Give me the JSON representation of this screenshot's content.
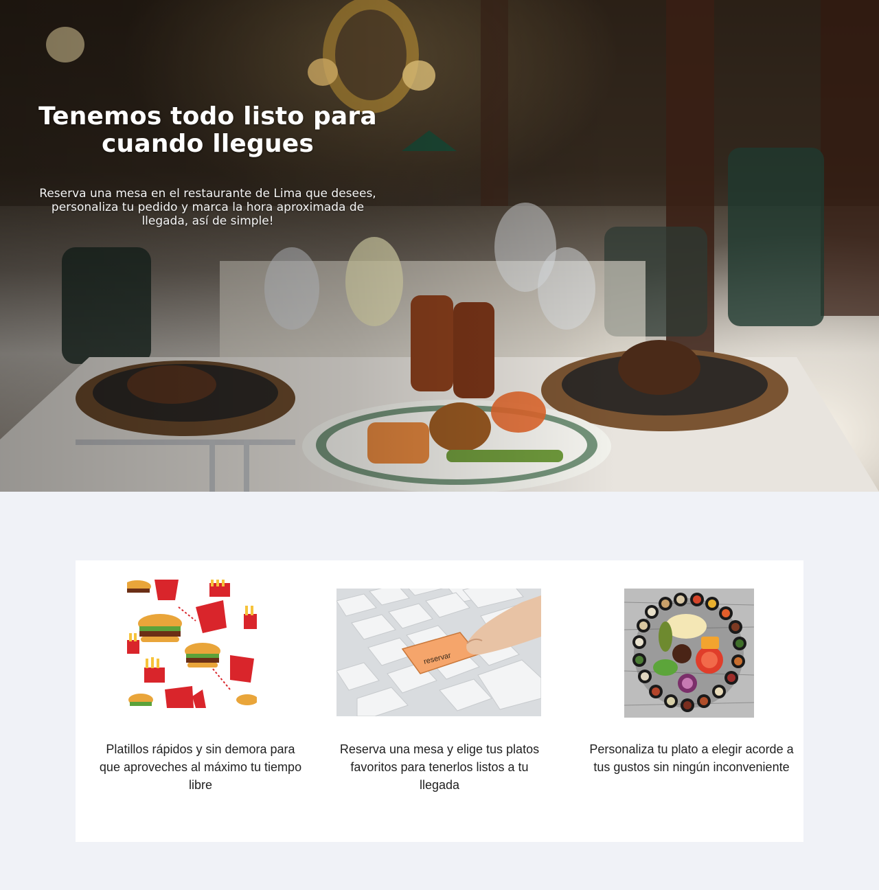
{
  "hero": {
    "title": "Tenemos todo listo para cuando llegues",
    "subtitle": "Reserva una mesa en el restaurante de Lima que desees, personaliza tu pedido y marca la hora aproximada de llegada, así de simple!"
  },
  "features": [
    {
      "image_icon": "fast-food-pattern-icon",
      "text": "Platillos rápidos y sin demora para que aproveches al máximo tu tiempo libre"
    },
    {
      "image_icon": "keyboard-reserve-key-icon",
      "key_label": "reservar",
      "text": "Reserva una mesa y elige tus platos favoritos para tenerlos listos a tu llegada"
    },
    {
      "image_icon": "custom-plate-ingredients-icon",
      "text": "Personaliza tu plato a elegir acorde a tus gustos sin ningún inconveniente"
    }
  ],
  "colors": {
    "page_background": "#f0f2f7",
    "card_background": "#ffffff",
    "reserve_key": "#f5a56b"
  }
}
